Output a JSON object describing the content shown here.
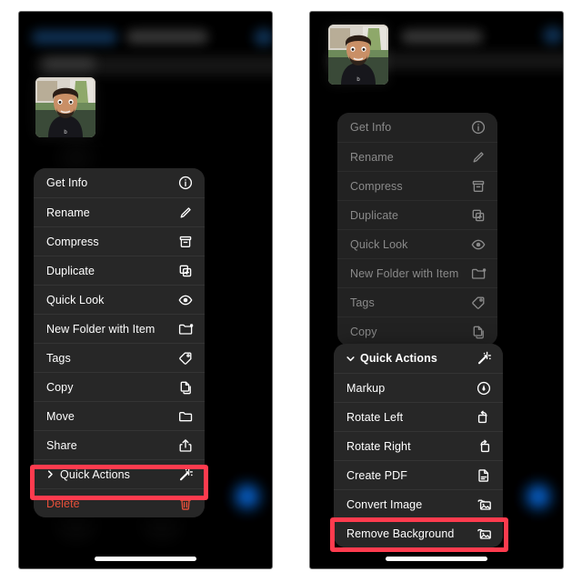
{
  "meta": {
    "platform": "iOS Files app context menu",
    "screens": 2,
    "accent_red": "#ff3b4e",
    "destructive_red": "#e8503a",
    "menu_bg": "#272727",
    "screen_bg": "#000000"
  },
  "left_screen": {
    "name": "context-menu-screen",
    "thumbnail_alt": "selfie photo thumbnail",
    "menu": {
      "items": [
        {
          "label": "Get Info",
          "icon": "info-circle-icon",
          "style": "normal",
          "expandable": false
        },
        {
          "label": "Rename",
          "icon": "pencil-icon",
          "style": "normal",
          "expandable": false
        },
        {
          "label": "Compress",
          "icon": "archive-box-icon",
          "style": "normal",
          "expandable": false
        },
        {
          "label": "Duplicate",
          "icon": "duplicate-icon",
          "style": "normal",
          "expandable": false
        },
        {
          "label": "Quick Look",
          "icon": "eye-icon",
          "style": "normal",
          "expandable": false
        },
        {
          "label": "New Folder with Item",
          "icon": "new-folder-icon",
          "style": "normal",
          "expandable": false
        },
        {
          "label": "Tags",
          "icon": "tag-icon",
          "style": "normal",
          "expandable": false
        },
        {
          "label": "Copy",
          "icon": "copy-icon",
          "style": "normal",
          "expandable": false
        },
        {
          "label": "Move",
          "icon": "folder-icon",
          "style": "normal",
          "expandable": false
        },
        {
          "label": "Share",
          "icon": "share-icon",
          "style": "normal",
          "expandable": false
        },
        {
          "label": "Quick Actions",
          "icon": "magic-wand-icon",
          "style": "normal",
          "expandable": true,
          "chevron": "chevron-right-icon",
          "highlighted": true
        },
        {
          "label": "Delete",
          "icon": "trash-icon",
          "style": "destructive",
          "expandable": false
        }
      ]
    },
    "highlight": {
      "target": "Quick Actions",
      "color": "#ff3b4e"
    }
  },
  "right_screen": {
    "name": "quick-actions-submenu-screen",
    "thumbnail_alt": "selfie photo thumbnail",
    "background_menu": {
      "dimmed": true,
      "items": [
        {
          "label": "Get Info",
          "icon": "info-circle-icon"
        },
        {
          "label": "Rename",
          "icon": "pencil-icon"
        },
        {
          "label": "Compress",
          "icon": "archive-box-icon"
        },
        {
          "label": "Duplicate",
          "icon": "duplicate-icon"
        },
        {
          "label": "Quick Look",
          "icon": "eye-icon"
        },
        {
          "label": "New Folder with Item",
          "icon": "new-folder-icon"
        },
        {
          "label": "Tags",
          "icon": "tag-icon"
        },
        {
          "label": "Copy",
          "icon": "copy-icon"
        }
      ]
    },
    "submenu": {
      "header": {
        "label": "Quick Actions",
        "icon": "magic-wand-icon",
        "chevron": "chevron-down-icon"
      },
      "items": [
        {
          "label": "Markup",
          "icon": "markup-icon",
          "highlighted": false
        },
        {
          "label": "Rotate Left",
          "icon": "rotate-left-icon",
          "highlighted": false
        },
        {
          "label": "Rotate Right",
          "icon": "rotate-right-icon",
          "highlighted": false
        },
        {
          "label": "Create PDF",
          "icon": "document-icon",
          "highlighted": false
        },
        {
          "label": "Convert Image",
          "icon": "convert-image-icon",
          "highlighted": false
        },
        {
          "label": "Remove Background",
          "icon": "remove-background-icon",
          "highlighted": true
        }
      ]
    },
    "highlight": {
      "target": "Remove Background",
      "color": "#ff3b4e"
    }
  }
}
